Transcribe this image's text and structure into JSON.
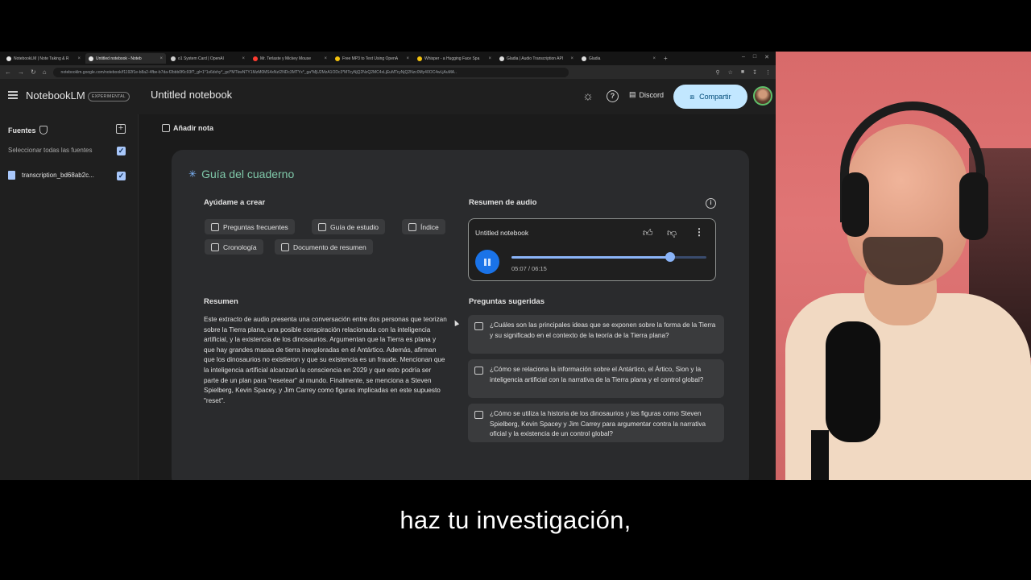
{
  "browser": {
    "tabs": [
      {
        "title": "NotebookLM | Note Taking & R",
        "color": "#e8e8e8"
      },
      {
        "title": "Untitled notebook - Noteb",
        "color": "#e8e8e8"
      },
      {
        "title": "o1 System Card | OpenAI",
        "color": "#cfcfcf"
      },
      {
        "title": "Mr. Terlaste y Mickey Mouse",
        "color": "#ff3b30"
      },
      {
        "title": "Free MP3 to Text Using OpenA",
        "color": "#f4c20d"
      },
      {
        "title": "Whisper - a Hugging Face Spa",
        "color": "#f4c20d"
      },
      {
        "title": "Gladia | Audio Transcription API",
        "color": "#dddddd"
      },
      {
        "title": "Gladia",
        "color": "#dddddd"
      }
    ],
    "url": "notebooklm.google.com/notebook/f1192f1e-b8a2-4fbe-b7da-f2bbb0f0c93f?_gl=1*1s6dxhy*_gcl*MTkwNTY1MzM0MS4xNzI2NDc3MTYx*_ga*MjU2MzA1ODc3*MTcyNjQ2NzQ2MC4xLjEuMTcyNjQ2Nzc0My40OC4wLjAuMA.."
  },
  "header": {
    "logo": "NotebookLM",
    "badge": "EXPERIMENTAL",
    "notebook_title": "Untitled notebook",
    "discord_label": "Discord",
    "share_label": "Compartir"
  },
  "sidebar": {
    "sources_title": "Fuentes",
    "select_all": "Seleccionar todas las fuentes",
    "source_item": "transcription_bd68ab2c..."
  },
  "main": {
    "add_note": "Añadir nota",
    "guide_title": "Guía del cuaderno",
    "help_create": "Ayúdame a crear",
    "chips": [
      "Preguntas frecuentes",
      "Guía de estudio",
      "Índice",
      "Cronología",
      "Documento de resumen"
    ],
    "summary_label": "Resumen",
    "summary_text": "Este extracto de audio presenta una conversación entre dos personas que teorizan sobre la Tierra plana, una posible conspiración relacionada con la inteligencia artificial, y la existencia de los dinosaurios. Argumentan que la Tierra es plana y que hay grandes masas de tierra inexploradas en el Antártico. Además, afirman que los dinosaurios no existieron y que su existencia es un fraude. Mencionan que la inteligencia artificial alcanzará la consciencia en 2029 y que esto podría ser parte de un plan para \"resetear\" al mundo. Finalmente, se menciona a Steven Spielberg, Kevin Spacey, y Jim Carrey como figuras implicadas en este supuesto \"reset\".",
    "audio_label": "Resumen de audio",
    "player_title": "Untitled notebook",
    "player_time": "05:07 / 06:15",
    "progress": 0.816,
    "suggested_label": "Preguntas sugeridas",
    "questions": [
      "¿Cuáles son las principales ideas que se exponen sobre la forma de la Tierra y su significado en el contexto de la teoría de la Tierra plana?",
      "¿Cómo se relaciona la información sobre el Antártico, el Ártico, Sion y la inteligencia artificial con la narrativa de la Tierra plana y el control global?",
      "¿Cómo se utiliza la historia de los dinosaurios y las figuras como Steven Spielberg, Kevin Spacey y Jim Carrey para argumentar contra la narrativa oficial y la existencia de un control global?"
    ]
  },
  "subtitle": "haz tu investigación,"
}
